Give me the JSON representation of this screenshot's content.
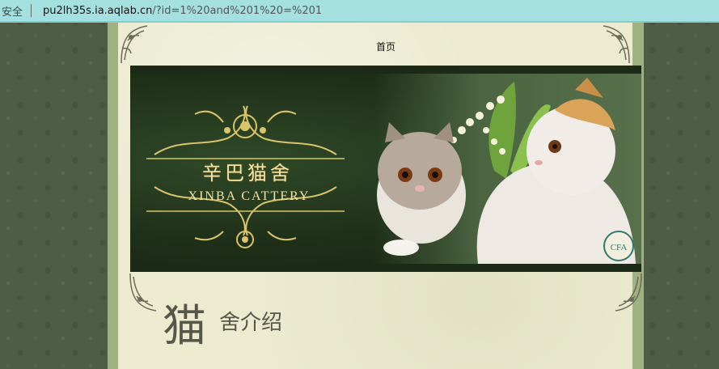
{
  "address_bar": {
    "security_label": "安全",
    "host": "pu2lh35s.ia.aqlab.cn",
    "path": "/?id=1%20and%201%20=%201"
  },
  "nav": {
    "home_label": "首页"
  },
  "banner": {
    "title_cn": "辛巴猫舍",
    "title_en": "XINBA CATTERY",
    "badge_text": "CFA"
  },
  "section": {
    "heading_big": "猫",
    "heading_small": "舍介绍"
  },
  "colors": {
    "background": "#4f5d45",
    "paper": "#ecebd0",
    "banner": "#263a21",
    "gold": "#d9c46a"
  }
}
